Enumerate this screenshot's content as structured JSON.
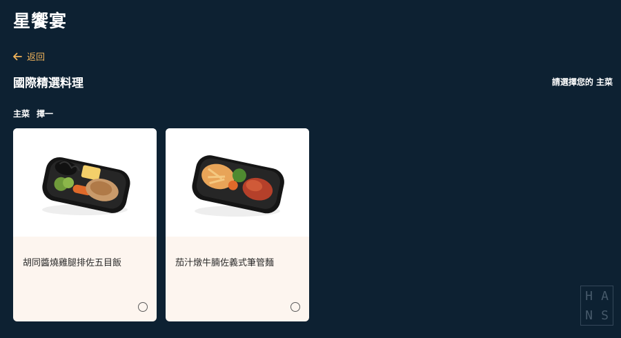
{
  "header": {
    "title": "星饗宴"
  },
  "nav": {
    "back_label": "返回"
  },
  "section": {
    "title": "國際精選料理",
    "hint": "請選擇您的 主菜"
  },
  "category": {
    "name": "主菜",
    "rule": "擇一"
  },
  "meals": [
    {
      "name": "胡同醬燒雞腿排佐五目飯",
      "selected": false
    },
    {
      "name": "茄汁燉牛腩佐義式筆管麵",
      "selected": false
    }
  ],
  "colors": {
    "background": "#0d2132",
    "accent": "#f0b35a",
    "card": "#fdf5ef"
  },
  "watermark": {
    "letters": [
      "H",
      "A",
      "N",
      "S"
    ]
  }
}
